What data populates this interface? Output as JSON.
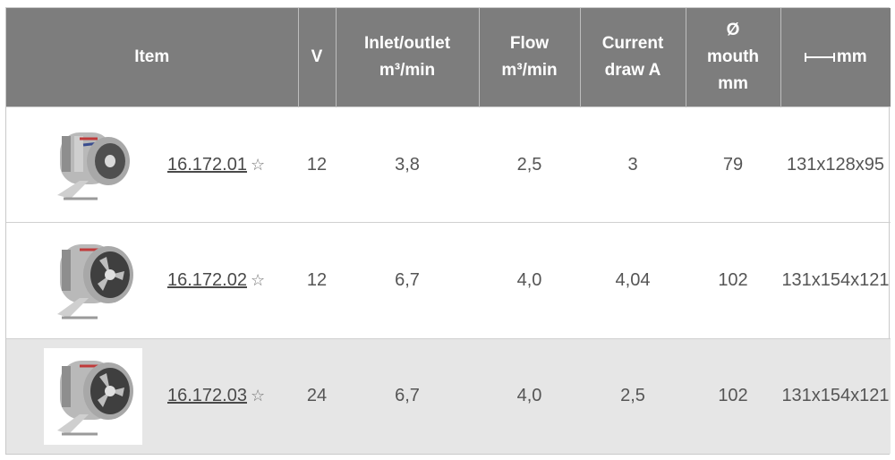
{
  "table": {
    "headers": {
      "item": "Item",
      "v": "V",
      "inlet_line1": "Inlet/outlet",
      "inlet_line2": "m³/min",
      "flow_line1": "Flow",
      "flow_line2": "m³/min",
      "current_line1": "Current",
      "current_line2": "draw A",
      "mouth_line1": "Ø",
      "mouth_line2": "mouth",
      "mouth_line3": "mm",
      "dims": "mm",
      "dims_icon": "dimension-arrow-icon"
    },
    "rows": [
      {
        "code": "16.172.01",
        "star": "☆",
        "v": "12",
        "inlet": "3,8",
        "flow": "2,5",
        "current": "3",
        "mouth": "79",
        "dims": "131x128x95",
        "image": "inline-blower-small"
      },
      {
        "code": "16.172.02",
        "star": "☆",
        "v": "12",
        "inlet": "6,7",
        "flow": "4,0",
        "current": "4,04",
        "mouth": "102",
        "dims": "131x154x121",
        "image": "inline-blower-large"
      },
      {
        "code": "16.172.03",
        "star": "☆",
        "v": "24",
        "inlet": "6,7",
        "flow": "4,0",
        "current": "2,5",
        "mouth": "102",
        "dims": "131x154x121",
        "image": "inline-blower-large"
      }
    ]
  },
  "colors": {
    "header_bg": "#7d7d7d",
    "header_text": "#ffffff",
    "shaded_row": "#e6e6e6",
    "body_text": "#555555"
  }
}
